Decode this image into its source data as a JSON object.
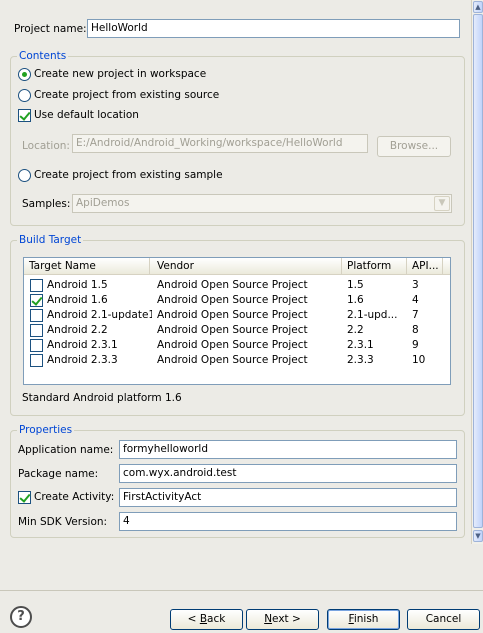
{
  "project_name": {
    "label": "Project name:",
    "value": "HelloWorld"
  },
  "contents": {
    "legend": "Contents",
    "options": [
      "Create new project in workspace",
      "Create project from existing source",
      "Create project from existing sample"
    ],
    "use_default_location": "Use default location",
    "location_label": "Location:",
    "location_value": "E:/Android/Android_Working/workspace/HelloWorld",
    "browse": "Browse...",
    "samples_label": "Samples:",
    "samples_value": "ApiDemos"
  },
  "build_target": {
    "legend": "Build Target",
    "columns": [
      "Target Name",
      "Vendor",
      "Platform",
      "API..."
    ],
    "rows": [
      {
        "name": "Android 1.5",
        "vendor": "Android Open Source Project",
        "platform": "1.5",
        "api": "3",
        "checked": false
      },
      {
        "name": "Android 1.6",
        "vendor": "Android Open Source Project",
        "platform": "1.6",
        "api": "4",
        "checked": true
      },
      {
        "name": "Android 2.1-update1",
        "vendor": "Android Open Source Project",
        "platform": "2.1-upd...",
        "api": "7",
        "checked": false
      },
      {
        "name": "Android 2.2",
        "vendor": "Android Open Source Project",
        "platform": "2.2",
        "api": "8",
        "checked": false
      },
      {
        "name": "Android 2.3.1",
        "vendor": "Android Open Source Project",
        "platform": "2.3.1",
        "api": "9",
        "checked": false
      },
      {
        "name": "Android 2.3.3",
        "vendor": "Android Open Source Project",
        "platform": "2.3.3",
        "api": "10",
        "checked": false
      }
    ],
    "description": "Standard Android platform 1.6"
  },
  "properties": {
    "legend": "Properties",
    "app_name_label": "Application name:",
    "app_name_value": "formyhelloworld",
    "package_label": "Package name:",
    "package_value": "com.wyx.android.test",
    "create_activity_label": "Create Activity:",
    "create_activity_value": "FirstActivityAct",
    "min_sdk_label": "Min SDK Version:",
    "min_sdk_value": "4"
  },
  "buttons": {
    "help": "?",
    "back_pre": "< ",
    "back_key": "B",
    "back_post": "ack",
    "next_key": "N",
    "next_post": "ext >",
    "finish_key": "F",
    "finish_post": "inish",
    "cancel": "Cancel"
  }
}
